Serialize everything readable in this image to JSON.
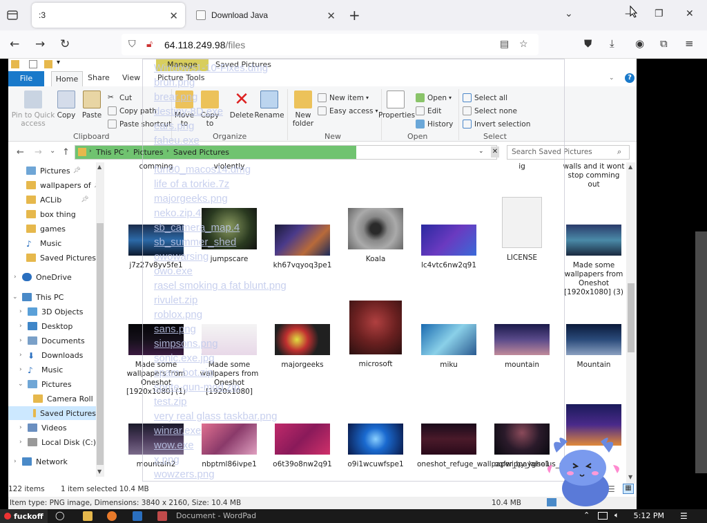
{
  "browser": {
    "tabs": [
      {
        "title": ":3",
        "active": true
      },
      {
        "title": "Download Java",
        "active": false
      }
    ],
    "url_host": "64.118.249.98",
    "url_path": "/files"
  },
  "ribbon": {
    "tabs": {
      "file": "File",
      "home": "Home",
      "share": "Share",
      "view": "View",
      "picture_tools": "Picture Tools"
    },
    "contextual": {
      "manage": "Manage",
      "saved_pictures": "Saved Pictures"
    },
    "clipboard": {
      "pin": "Pin to Quick access",
      "copy": "Copy",
      "paste": "Paste",
      "cut": "Cut",
      "copy_path": "Copy path",
      "paste_shortcut": "Paste shortcut",
      "label": "Clipboard"
    },
    "organize": {
      "move_to": "Move to",
      "copy_to": "Copy to",
      "delete": "Delete",
      "rename": "Rename",
      "label": "Organize"
    },
    "new": {
      "new_folder": "New folder",
      "new_item": "New item",
      "easy_access": "Easy access",
      "label": "New"
    },
    "open": {
      "properties": "Properties",
      "open": "Open",
      "edit": "Edit",
      "history": "History",
      "label": "Open"
    },
    "select": {
      "select_all": "Select all",
      "select_none": "Select none",
      "invert": "Invert selection",
      "label": "Select"
    }
  },
  "address": {
    "crumbs": [
      "This PC",
      "Pictures",
      "Saved Pictures"
    ],
    "search_placeholder": "Search Saved Pictures"
  },
  "navpane": {
    "items": [
      {
        "label": "Pictures",
        "pinned": true
      },
      {
        "label": "wallpapers of",
        "pinned": true
      },
      {
        "label": "ACLib",
        "pinned": true
      },
      {
        "label": "box thing",
        "pinned": false
      },
      {
        "label": "games",
        "pinned": false
      },
      {
        "label": "Music",
        "pinned": false
      },
      {
        "label": "Saved Pictures",
        "pinned": false
      },
      {
        "label": "OneDrive",
        "pinned": false
      },
      {
        "label": "This PC",
        "pinned": false
      },
      {
        "label": "3D Objects",
        "pinned": false
      },
      {
        "label": "Desktop",
        "pinned": false
      },
      {
        "label": "Documents",
        "pinned": false
      },
      {
        "label": "Downloads",
        "pinned": false
      },
      {
        "label": "Music",
        "pinned": false
      },
      {
        "label": "Pictures",
        "pinned": false
      },
      {
        "label": "Camera Roll",
        "pinned": false
      },
      {
        "label": "Saved Pictures",
        "pinned": false
      },
      {
        "label": "Videos",
        "pinned": false
      },
      {
        "label": "Local Disk (C:)",
        "pinned": false
      },
      {
        "label": "Network",
        "pinned": false
      }
    ]
  },
  "files": {
    "top_partial": [
      "comming",
      "violently",
      "ig",
      "walls and it wont stop comming out"
    ],
    "row1": [
      "j7z27v8yv5fe1",
      "jumpscare",
      "kh67vqyoq3pe1",
      "Koala",
      "lc4vtc6nw2q91",
      "LICENSE",
      "Made some wallpapers from Oneshot [1920x1080] (3)"
    ],
    "row2": [
      "Made some wallpapers from Oneshot [1920x1080] (1)",
      "Made some wallpapers from Oneshot [1920x1080]",
      "majorgeeks",
      "microsoft",
      "miku",
      "mountain",
      "Mountain"
    ],
    "row3": [
      "mountain2",
      "nbptml86ivpe1",
      "o6t39o8nw2q91",
      "o9i1wcuwfspe1",
      "oneshot_refuge_wallpaper_by_laisolus_de78wz6",
      "oqfwippayghe1",
      ""
    ]
  },
  "status": {
    "count": "122 items",
    "selected": "1 item selected 10.4 MB",
    "details": "Item type: PNG image, Dimensions: 3840 x 2160, Size: 10.4 MB",
    "size": "10.4 MB"
  },
  "overlay_files": [
    "Windows1-10-Fixes.dmg",
    "bruh.png",
    "brear.png",
    "destiny-8D.exe",
    "ears.png",
    "faheu.exe",
    "fun80_macos14.dmg",
    "life of a torkie.7z",
    "majorgeeks.png",
    "neko.zip.4",
    "sb_camera_map.4",
    "sb_summer_shed",
    "owowarsing",
    "owo.exe",
    "rasel smoking a fat blunt.png",
    "rivulet.zip",
    "roblox.png",
    "sans.png",
    "simpsons.png",
    "sonic.exe.jpg",
    "spam-bot.zip",
    "sprite-gun-mod.zip",
    "test.zip",
    "very real glass taskbar.png",
    "winrar.exe",
    "wow.exe",
    "x.png",
    "wowzers.png"
  ],
  "taskbar": {
    "start_label": "fuckoff",
    "task_label": "Document - WordPad",
    "time": "5:12 PM"
  }
}
